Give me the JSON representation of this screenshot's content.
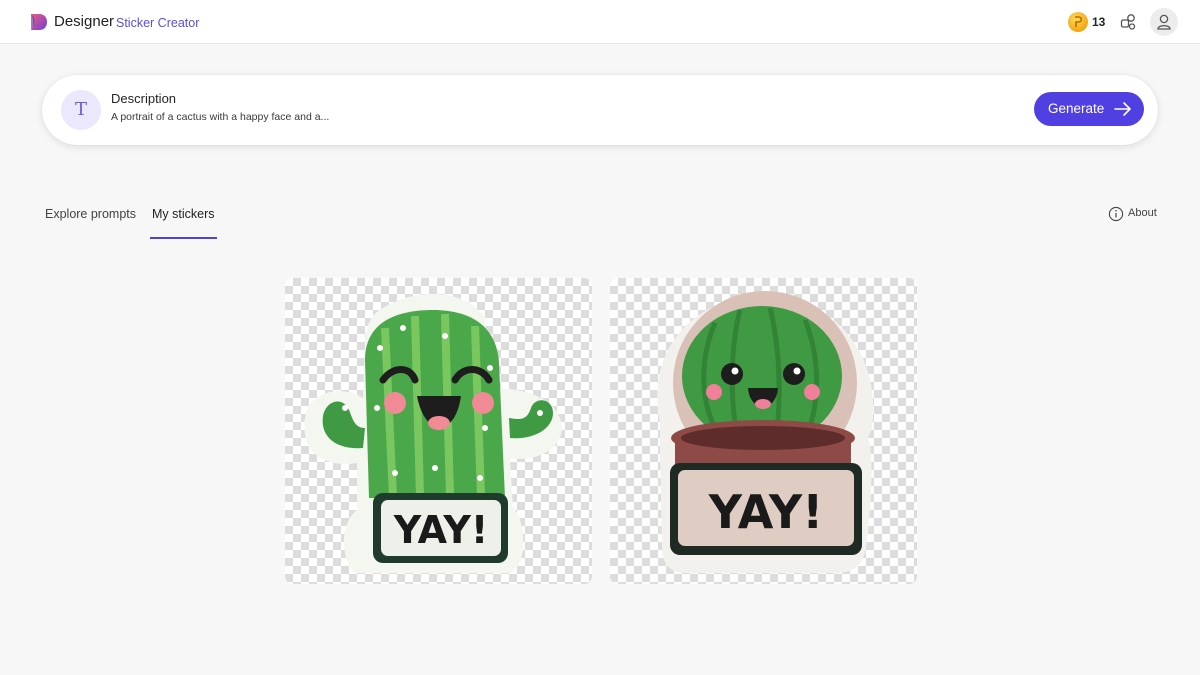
{
  "header": {
    "app_name": "Designer",
    "product_name": "Sticker Creator",
    "credits": "13",
    "icons": [
      "designer-logo",
      "coin-icon",
      "apps-icon",
      "account-icon"
    ]
  },
  "description": {
    "label": "Description",
    "value": "A portrait of a cactus with a happy face and a...",
    "icon_letter": "T"
  },
  "generate": {
    "label": "Generate"
  },
  "tabs": [
    {
      "label": "Explore prompts",
      "selected": false
    },
    {
      "label": "My stickers",
      "selected": true
    }
  ],
  "about": {
    "label": "About"
  },
  "stickers": [
    {
      "text": "YAY!",
      "subject": "cactus-waving"
    },
    {
      "text": "YAY!",
      "subject": "cactus-in-pot"
    }
  ],
  "colors": {
    "accent": "#5040e2",
    "subbrand": "#5b4fd6",
    "cactus": "#3d9b3f",
    "pot": "#8e4a46"
  }
}
